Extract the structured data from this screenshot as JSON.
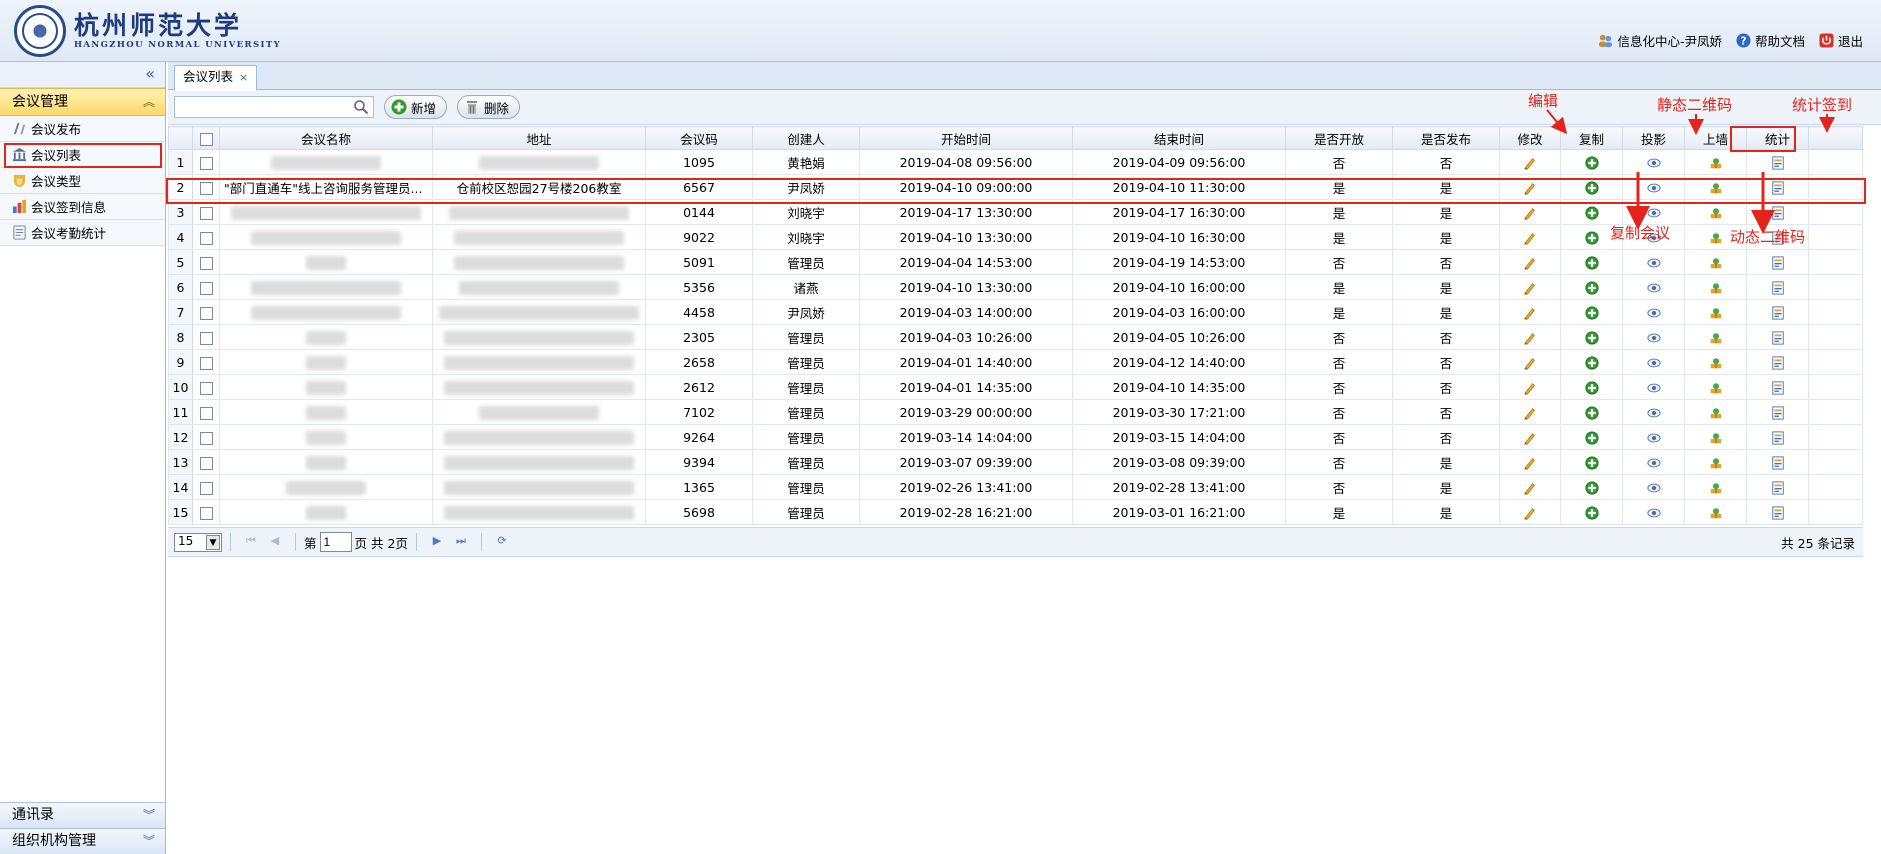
{
  "header": {
    "univ_cn": "杭州师范大学",
    "univ_en": "HANGZHOU NORMAL UNIVERSITY",
    "user_link": "信息化中心-尹凤娇",
    "help_link": "帮助文档",
    "logout_link": "退出"
  },
  "sidebar": {
    "collapse_icon": "«",
    "section_title": "会议管理",
    "items": [
      {
        "label": "会议发布",
        "icon": "publish-icon"
      },
      {
        "label": "会议列表",
        "icon": "list-icon"
      },
      {
        "label": "会议类型",
        "icon": "type-icon"
      },
      {
        "label": "会议签到信息",
        "icon": "checkin-icon"
      },
      {
        "label": "会议考勤统计",
        "icon": "attendance-icon"
      }
    ],
    "bottom_sections": [
      "通讯录",
      "组织机构管理"
    ]
  },
  "tab": {
    "label": "会议列表",
    "close": "×"
  },
  "toolbar": {
    "search_placeholder": "",
    "add_label": "新增",
    "delete_label": "删除"
  },
  "table": {
    "columns": [
      "会议名称",
      "地址",
      "会议码",
      "创建人",
      "开始时间",
      "结束时间",
      "是否开放",
      "是否发布",
      "修改",
      "复制",
      "投影",
      "上墙",
      "统计"
    ],
    "rows": [
      {
        "no": "1",
        "name": "",
        "addr": "",
        "code": "1095",
        "creator": "黄艳娟",
        "start": "2019-04-08 09:56:00",
        "end": "2019-04-09 09:56:00",
        "open": "否",
        "pub": "否"
      },
      {
        "no": "2",
        "name": "\"部门直通车\"线上咨询服务管理员...",
        "addr": "仓前校区恕园27号楼206教室",
        "code": "6567",
        "creator": "尹凤娇",
        "start": "2019-04-10 09:00:00",
        "end": "2019-04-10 11:30:00",
        "open": "是",
        "pub": "是"
      },
      {
        "no": "3",
        "name": "",
        "addr": "",
        "code": "0144",
        "creator": "刘晓宇",
        "start": "2019-04-17 13:30:00",
        "end": "2019-04-17 16:30:00",
        "open": "是",
        "pub": "是"
      },
      {
        "no": "4",
        "name": "",
        "addr": "",
        "code": "9022",
        "creator": "刘晓宇",
        "start": "2019-04-10 13:30:00",
        "end": "2019-04-10 16:30:00",
        "open": "是",
        "pub": "是"
      },
      {
        "no": "5",
        "name": "",
        "addr": "",
        "code": "5091",
        "creator": "管理员",
        "start": "2019-04-04 14:53:00",
        "end": "2019-04-19 14:53:00",
        "open": "否",
        "pub": "否"
      },
      {
        "no": "6",
        "name": "",
        "addr": "",
        "code": "5356",
        "creator": "诸燕",
        "start": "2019-04-10 13:30:00",
        "end": "2019-04-10 16:00:00",
        "open": "是",
        "pub": "是"
      },
      {
        "no": "7",
        "name": "",
        "addr": "",
        "code": "4458",
        "creator": "尹凤娇",
        "start": "2019-04-03 14:00:00",
        "end": "2019-04-03 16:00:00",
        "open": "是",
        "pub": "是"
      },
      {
        "no": "8",
        "name": "",
        "addr": "",
        "code": "2305",
        "creator": "管理员",
        "start": "2019-04-03 10:26:00",
        "end": "2019-04-05 10:26:00",
        "open": "否",
        "pub": "否"
      },
      {
        "no": "9",
        "name": "",
        "addr": "",
        "code": "2658",
        "creator": "管理员",
        "start": "2019-04-01 14:40:00",
        "end": "2019-04-12 14:40:00",
        "open": "否",
        "pub": "否"
      },
      {
        "no": "10",
        "name": "",
        "addr": "",
        "code": "2612",
        "creator": "管理员",
        "start": "2019-04-01 14:35:00",
        "end": "2019-04-10 14:35:00",
        "open": "否",
        "pub": "否"
      },
      {
        "no": "11",
        "name": "",
        "addr": "",
        "code": "7102",
        "creator": "管理员",
        "start": "2019-03-29 00:00:00",
        "end": "2019-03-30 17:21:00",
        "open": "否",
        "pub": "否"
      },
      {
        "no": "12",
        "name": "",
        "addr": "",
        "code": "9264",
        "creator": "管理员",
        "start": "2019-03-14 14:04:00",
        "end": "2019-03-15 14:04:00",
        "open": "否",
        "pub": "否"
      },
      {
        "no": "13",
        "name": "",
        "addr": "",
        "code": "9394",
        "creator": "管理员",
        "start": "2019-03-07 09:39:00",
        "end": "2019-03-08 09:39:00",
        "open": "否",
        "pub": "是"
      },
      {
        "no": "14",
        "name": "",
        "addr": "",
        "code": "1365",
        "creator": "管理员",
        "start": "2019-02-26 13:41:00",
        "end": "2019-02-28 13:41:00",
        "open": "否",
        "pub": "是"
      },
      {
        "no": "15",
        "name": "",
        "addr": "",
        "code": "5698",
        "creator": "管理员",
        "start": "2019-02-28 16:21:00",
        "end": "2019-03-01 16:21:00",
        "open": "是",
        "pub": "是"
      }
    ]
  },
  "pager": {
    "page_size": "15",
    "page_prefix": "第",
    "page_value": "1",
    "page_suffix": "页 共 2页",
    "total": "共 25 条记录"
  },
  "annotations": {
    "edit": "编辑",
    "static_qr": "静态二维码",
    "stats_checkin": "统计签到",
    "copy_meeting": "复制会议",
    "dynamic_qr": "动态二维码"
  },
  "colors": {
    "annotation_red": "#e4241b",
    "header_blue": "#1d3b7d",
    "accordion_yellow": "#fbd869"
  }
}
